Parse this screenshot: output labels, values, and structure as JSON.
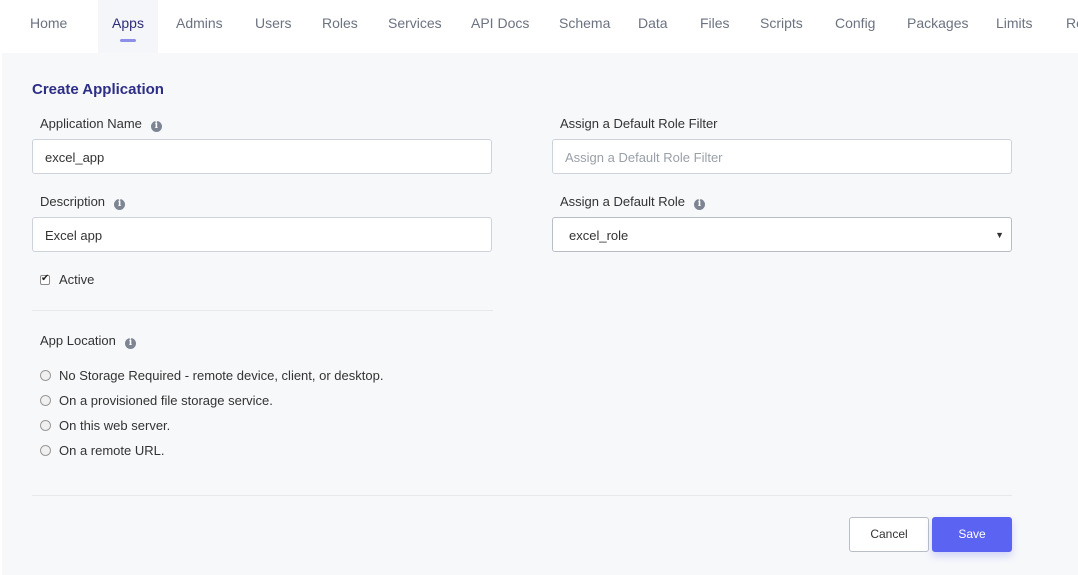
{
  "nav": {
    "items": [
      "Home",
      "Apps",
      "Admins",
      "Users",
      "Roles",
      "Services",
      "API Docs",
      "Schema",
      "Data",
      "Files",
      "Scripts",
      "Config",
      "Packages",
      "Limits",
      "Re"
    ],
    "active": "Apps"
  },
  "form": {
    "title": "Create Application",
    "app_name_label": "Application Name",
    "app_name_value": "excel_app",
    "description_label": "Description",
    "description_value": "Excel app",
    "active_label": "Active",
    "active_checked": true,
    "role_filter_label": "Assign a Default Role Filter",
    "role_filter_placeholder": "Assign a Default Role Filter",
    "default_role_label": "Assign a Default Role",
    "default_role_value": "excel_role",
    "app_location_label": "App Location",
    "app_location_options": [
      "No Storage Required - remote device, client, or desktop.",
      "On a provisioned file storage service.",
      "On this web server.",
      "On a remote URL."
    ]
  },
  "buttons": {
    "cancel": "Cancel",
    "save": "Save"
  },
  "icons": {
    "info": "info-icon",
    "dropdown": "caret-down-icon",
    "check": "checkmark-icon"
  },
  "colors": {
    "accent": "#5b63f2",
    "title": "#2d2e87",
    "nav_active_underline": "#8b8fe8"
  }
}
